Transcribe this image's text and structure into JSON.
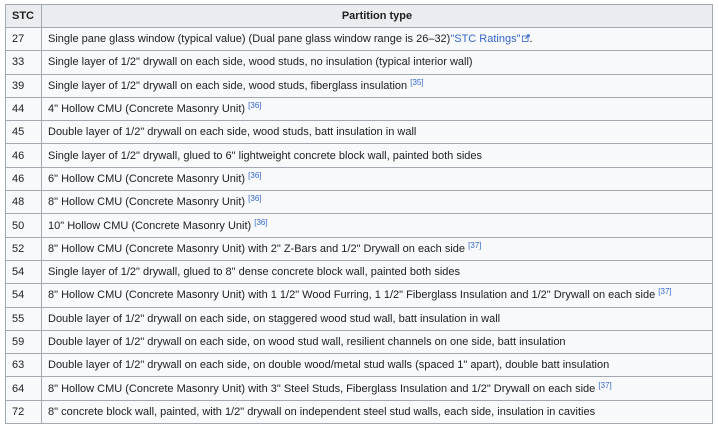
{
  "table": {
    "headers": [
      "STC",
      "Partition type"
    ],
    "rows": [
      {
        "stc": "27",
        "type": "Single pane glass window (typical value) (Dual pane glass window range is 26–32)",
        "link": "\"STC Ratings\"",
        "ref": ""
      },
      {
        "stc": "33",
        "type": "Single layer of 1/2\" drywall on each side, wood studs, no insulation (typical interior wall)",
        "ref": ""
      },
      {
        "stc": "39",
        "type": "Single layer of 1/2\" drywall on each side, wood studs, fiberglass insulation",
        "ref": "[35]"
      },
      {
        "stc": "44",
        "type": "4\" Hollow CMU (Concrete Masonry Unit)",
        "ref": "[36]"
      },
      {
        "stc": "45",
        "type": "Double layer of 1/2\" drywall on each side, wood studs, batt insulation in wall",
        "ref": ""
      },
      {
        "stc": "46",
        "type": "Single layer of 1/2\" drywall, glued to 6\" lightweight concrete block wall, painted both sides",
        "ref": ""
      },
      {
        "stc": "46",
        "type": "6\" Hollow CMU (Concrete Masonry Unit)",
        "ref": "[36]"
      },
      {
        "stc": "48",
        "type": "8\" Hollow CMU (Concrete Masonry Unit)",
        "ref": "[36]"
      },
      {
        "stc": "50",
        "type": "10\" Hollow CMU (Concrete Masonry Unit)",
        "ref": "[36]"
      },
      {
        "stc": "52",
        "type": "8\" Hollow CMU (Concrete Masonry Unit) with 2\" Z-Bars and 1/2\" Drywall on each side",
        "ref": "[37]"
      },
      {
        "stc": "54",
        "type": "Single layer of 1/2\" drywall, glued to 8\" dense concrete block wall, painted both sides",
        "ref": ""
      },
      {
        "stc": "54",
        "type": "8\" Hollow CMU (Concrete Masonry Unit) with 1 1/2\" Wood Furring, 1 1/2\" Fiberglass Insulation and 1/2\" Drywall on each side",
        "ref": "[37]"
      },
      {
        "stc": "55",
        "type": "Double layer of 1/2\" drywall on each side, on staggered wood stud wall, batt insulation in wall",
        "ref": ""
      },
      {
        "stc": "59",
        "type": "Double layer of 1/2\" drywall on each side, on wood stud wall, resilient channels on one side, batt insulation",
        "ref": ""
      },
      {
        "stc": "63",
        "type": "Double layer of 1/2\" drywall on each side, on double wood/metal stud walls (spaced 1\" apart), double batt insulation",
        "ref": ""
      },
      {
        "stc": "64",
        "type": "8\" Hollow CMU (Concrete Masonry Unit) with 3\" Steel Studs, Fiberglass Insulation and 1/2\" Drywall on each side",
        "ref": "[37]"
      },
      {
        "stc": "72",
        "type": "8\" concrete block wall, painted, with 1/2\" drywall on independent steel stud walls, each side, insulation in cavities",
        "ref": ""
      }
    ]
  },
  "colors": {
    "link": "#3366cc",
    "header_bg": "#eaecf0",
    "cell_bg": "#f8f9fa",
    "border": "#a2a9b1"
  },
  "icons": {
    "external_link": "external-link-icon"
  }
}
